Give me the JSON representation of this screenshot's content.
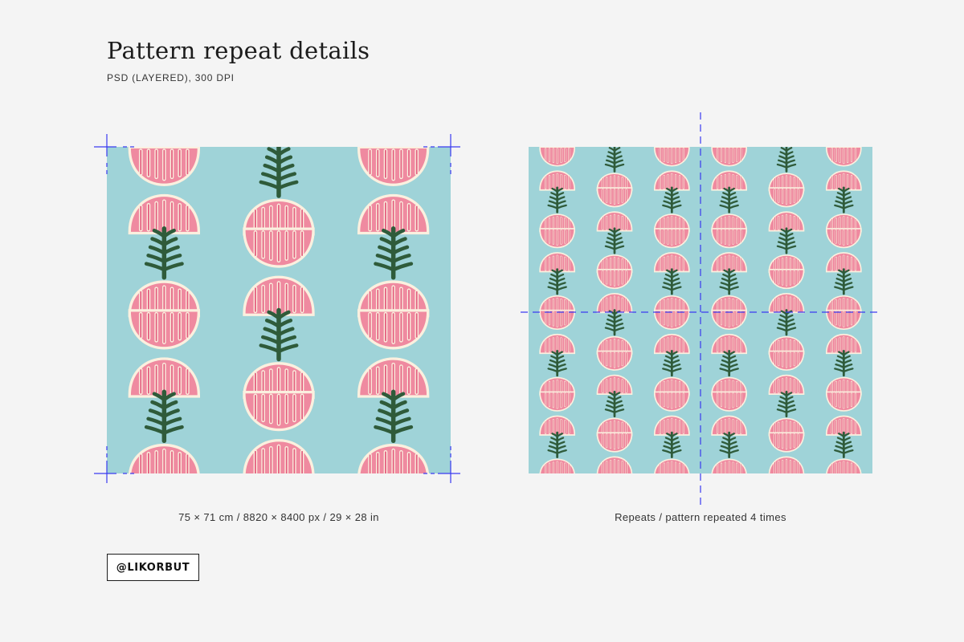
{
  "header": {
    "title": "Pattern repeat details",
    "subtitle": "PSD (LAYERED), 300 DPI"
  },
  "left_panel": {
    "caption": "75 × 71 cm / 8820 × 8400 px / 29 × 28 in"
  },
  "right_panel": {
    "caption": "Repeats / pattern repeated 4 times",
    "repeat_count": 4
  },
  "badge": {
    "label": "@LIKORBUT"
  },
  "colors": {
    "background": "#f4f4f4",
    "pattern_ground": "#9fd3d8",
    "petal_pink": "#ef8aa0",
    "petal_cream": "#fbf0df",
    "petal_stripe": "#e45f80",
    "leaf_green": "#2f5b3a",
    "guide_blue": "#3a3af0",
    "text_dark": "#1c1c1c"
  }
}
